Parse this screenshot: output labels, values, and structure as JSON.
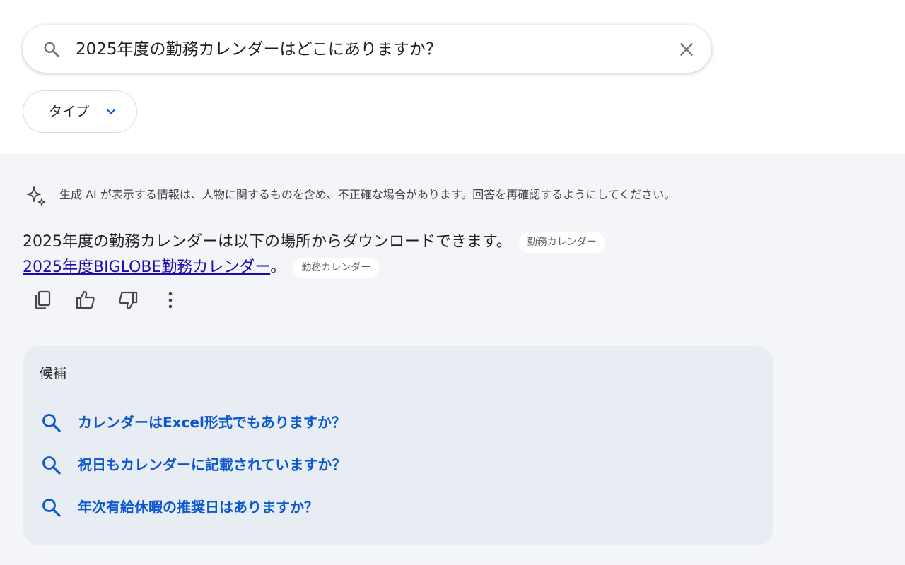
{
  "search": {
    "query": "2025年度の勤務カレンダーはどこにありますか？",
    "icon": "search-icon",
    "clear_icon": "close-icon"
  },
  "filters": {
    "type_label": "タイプ"
  },
  "ai_overview": {
    "disclaimer": "生成 AI が表示する情報は、人物に関するものを含め、不正確な場合があります。回答を再確認するようにしてください。",
    "answer_line1": "2025年度の勤務カレンダーは以下の場所からダウンロードできます。",
    "source_chip_1": "勤務カレンダー",
    "answer_link": "2025年度BIGLOBE勤務カレンダー",
    "answer_link_suffix": "。",
    "source_chip_2": "勤務カレンダー"
  },
  "candidates": {
    "title": "候補",
    "items": [
      {
        "label": "カレンダーはExcel形式でもありますか？"
      },
      {
        "label": "祝日もカレンダーに記載されていますか？"
      },
      {
        "label": "年次有給休暇の推奨日はありますか？"
      }
    ]
  },
  "colors": {
    "link": "#1a0dab",
    "suggestion": "#0b57d0",
    "panel_bg": "#f3f5f9",
    "candidate_bg": "#e8ecf3"
  }
}
